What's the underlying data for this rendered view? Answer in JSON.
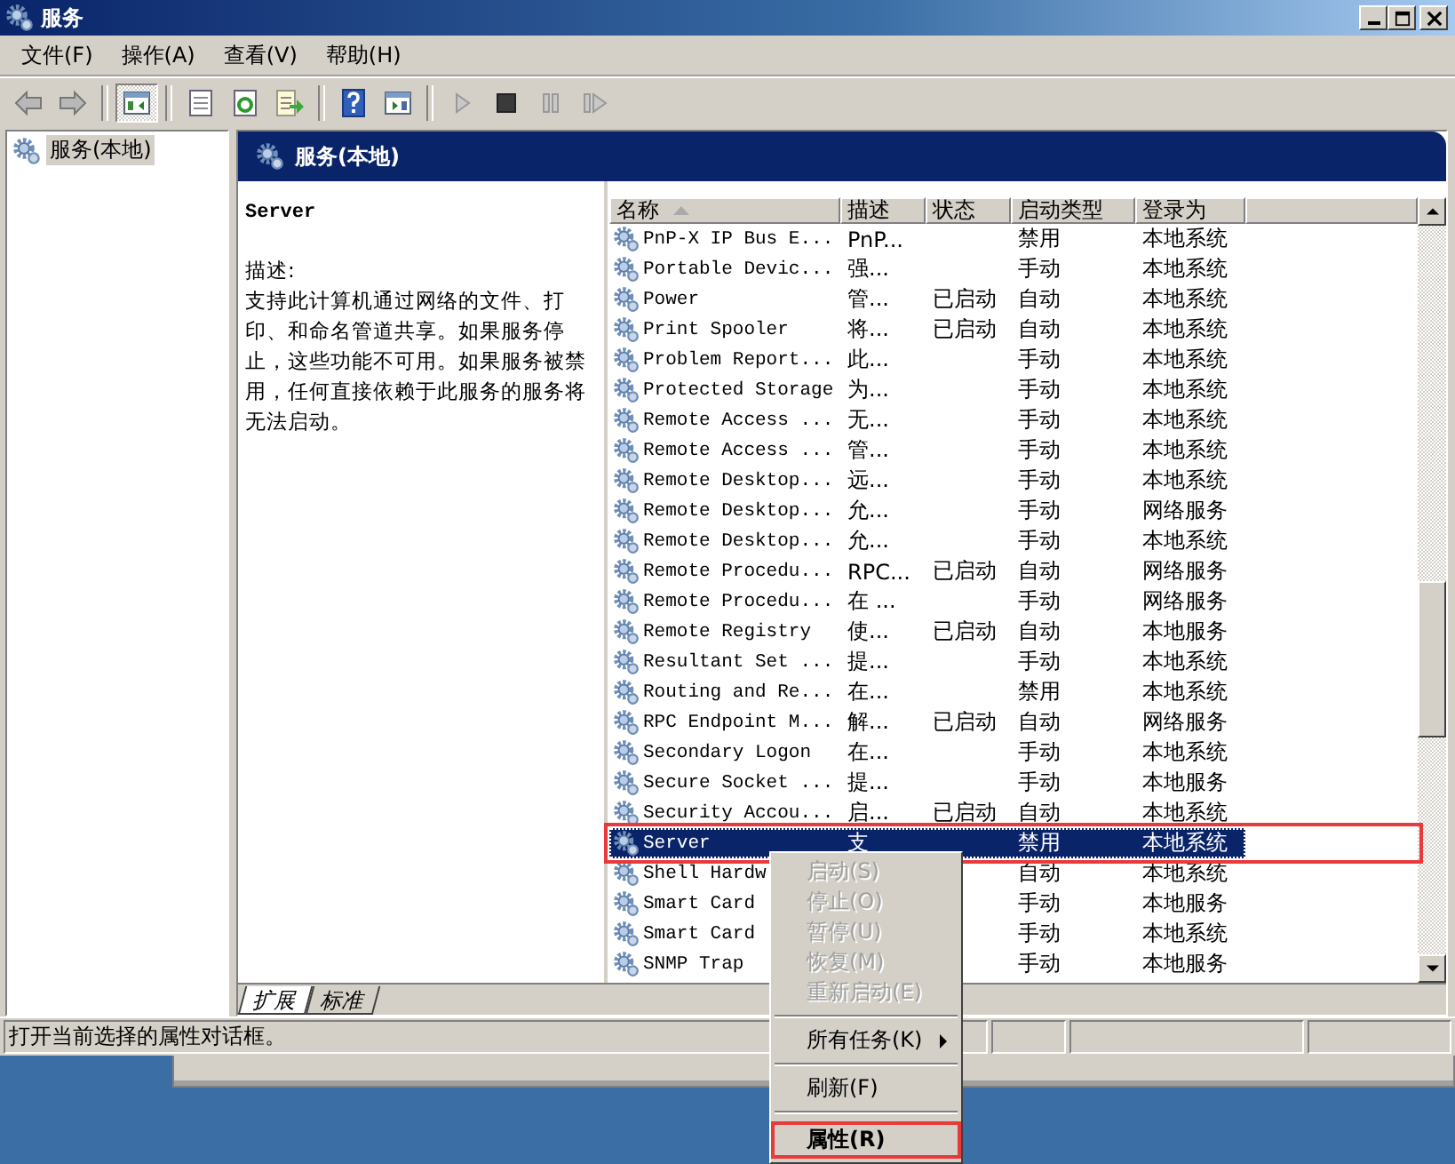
{
  "window": {
    "title": "服务"
  },
  "menu_bar": [
    "文件(F)",
    "操作(A)",
    "查看(V)",
    "帮助(H)"
  ],
  "toolbar": [
    {
      "kind": "back",
      "pressed": false
    },
    {
      "kind": "forward",
      "pressed": false
    },
    {
      "kind": "separator"
    },
    {
      "kind": "console-tree",
      "pressed": true
    },
    {
      "kind": "separator"
    },
    {
      "kind": "properties",
      "pressed": false
    },
    {
      "kind": "refresh",
      "pressed": false
    },
    {
      "kind": "export",
      "pressed": false
    },
    {
      "kind": "separator"
    },
    {
      "kind": "help",
      "pressed": false
    },
    {
      "kind": "action-pane",
      "pressed": false
    },
    {
      "kind": "separator"
    },
    {
      "kind": "play",
      "pressed": false,
      "disabled": true
    },
    {
      "kind": "stop",
      "pressed": false,
      "disabled": false
    },
    {
      "kind": "pause",
      "pressed": false,
      "disabled": true
    },
    {
      "kind": "resume",
      "pressed": false,
      "disabled": true
    }
  ],
  "tree": [
    {
      "label": "服务(本地)",
      "selected": true
    }
  ],
  "header": {
    "title": "服务(本地)"
  },
  "description": {
    "service_name": "Server",
    "label": "描述:",
    "text": "支持此计算机通过网络的文件、打印、和命名管道共享。如果服务停止，这些功能不可用。如果服务被禁用，任何直接依赖于此服务的服务将无法启动。"
  },
  "columns": [
    {
      "label": "名称",
      "sorted": true
    },
    {
      "label": "描述",
      "sorted": false
    },
    {
      "label": "状态",
      "sorted": false
    },
    {
      "label": "启动类型",
      "sorted": false
    },
    {
      "label": "登录为",
      "sorted": false
    }
  ],
  "rows": [
    {
      "name": "PnP-X IP Bus E...",
      "description": "PnP...",
      "status": "",
      "startup": "禁用",
      "logon": "本地系统",
      "selected": false,
      "highlighted": false
    },
    {
      "name": "Portable Devic...",
      "description": "强...",
      "status": "",
      "startup": "手动",
      "logon": "本地系统",
      "selected": false,
      "highlighted": false
    },
    {
      "name": "Power",
      "description": "管...",
      "status": "已启动",
      "startup": "自动",
      "logon": "本地系统",
      "selected": false,
      "highlighted": false
    },
    {
      "name": "Print Spooler",
      "description": "将...",
      "status": "已启动",
      "startup": "自动",
      "logon": "本地系统",
      "selected": false,
      "highlighted": false
    },
    {
      "name": "Problem Report...",
      "description": "此...",
      "status": "",
      "startup": "手动",
      "logon": "本地系统",
      "selected": false,
      "highlighted": false
    },
    {
      "name": "Protected Storage",
      "description": "为...",
      "status": "",
      "startup": "手动",
      "logon": "本地系统",
      "selected": false,
      "highlighted": false
    },
    {
      "name": "Remote Access ...",
      "description": "无...",
      "status": "",
      "startup": "手动",
      "logon": "本地系统",
      "selected": false,
      "highlighted": false
    },
    {
      "name": "Remote Access ...",
      "description": "管...",
      "status": "",
      "startup": "手动",
      "logon": "本地系统",
      "selected": false,
      "highlighted": false
    },
    {
      "name": "Remote Desktop...",
      "description": "远...",
      "status": "",
      "startup": "手动",
      "logon": "本地系统",
      "selected": false,
      "highlighted": false
    },
    {
      "name": "Remote Desktop...",
      "description": "允...",
      "status": "",
      "startup": "手动",
      "logon": "网络服务",
      "selected": false,
      "highlighted": false
    },
    {
      "name": "Remote Desktop...",
      "description": "允...",
      "status": "",
      "startup": "手动",
      "logon": "本地系统",
      "selected": false,
      "highlighted": false
    },
    {
      "name": "Remote Procedu...",
      "description": "RPC...",
      "status": "已启动",
      "startup": "自动",
      "logon": "网络服务",
      "selected": false,
      "highlighted": false
    },
    {
      "name": "Remote Procedu...",
      "description": "在 ...",
      "status": "",
      "startup": "手动",
      "logon": "网络服务",
      "selected": false,
      "highlighted": false
    },
    {
      "name": "Remote Registry",
      "description": "使...",
      "status": "已启动",
      "startup": "自动",
      "logon": "本地服务",
      "selected": false,
      "highlighted": false
    },
    {
      "name": "Resultant Set ...",
      "description": "提...",
      "status": "",
      "startup": "手动",
      "logon": "本地系统",
      "selected": false,
      "highlighted": false
    },
    {
      "name": "Routing and Re...",
      "description": "在...",
      "status": "",
      "startup": "禁用",
      "logon": "本地系统",
      "selected": false,
      "highlighted": false
    },
    {
      "name": "RPC Endpoint M...",
      "description": "解...",
      "status": "已启动",
      "startup": "自动",
      "logon": "网络服务",
      "selected": false,
      "highlighted": false
    },
    {
      "name": "Secondary Logon",
      "description": "在...",
      "status": "",
      "startup": "手动",
      "logon": "本地系统",
      "selected": false,
      "highlighted": false
    },
    {
      "name": "Secure Socket ...",
      "description": "提...",
      "status": "",
      "startup": "手动",
      "logon": "本地服务",
      "selected": false,
      "highlighted": false
    },
    {
      "name": "Security Accou...",
      "description": "启...",
      "status": "已启动",
      "startup": "自动",
      "logon": "本地系统",
      "selected": false,
      "highlighted": false
    },
    {
      "name": "Server",
      "description": "支",
      "status": "",
      "startup": "禁用",
      "logon": "本地系统",
      "selected": true,
      "highlighted": true
    },
    {
      "name": "Shell Hardw",
      "description": "",
      "status": "",
      "startup": "自动",
      "logon": "本地系统",
      "selected": false,
      "highlighted": false
    },
    {
      "name": "Smart Card",
      "description": "",
      "status": "",
      "startup": "手动",
      "logon": "本地服务",
      "selected": false,
      "highlighted": false
    },
    {
      "name": "Smart Card",
      "description": "",
      "status": "",
      "startup": "手动",
      "logon": "本地系统",
      "selected": false,
      "highlighted": false
    },
    {
      "name": "SNMP Trap",
      "description": "",
      "status": "",
      "startup": "手动",
      "logon": "本地服务",
      "selected": false,
      "highlighted": false
    }
  ],
  "tabs": [
    {
      "label": "扩展",
      "selected": true
    },
    {
      "label": "标准",
      "selected": false
    }
  ],
  "status_bar": "打开当前选择的属性对话框。",
  "context_menu": [
    {
      "kind": "item",
      "label": "启动(S)",
      "disabled": true,
      "default": false,
      "submenu": false,
      "highlighted": false
    },
    {
      "kind": "item",
      "label": "停止(O)",
      "disabled": true,
      "default": false,
      "submenu": false,
      "highlighted": false
    },
    {
      "kind": "item",
      "label": "暂停(U)",
      "disabled": true,
      "default": false,
      "submenu": false,
      "highlighted": false
    },
    {
      "kind": "item",
      "label": "恢复(M)",
      "disabled": true,
      "default": false,
      "submenu": false,
      "highlighted": false
    },
    {
      "kind": "item",
      "label": "重新启动(E)",
      "disabled": true,
      "default": false,
      "submenu": false,
      "highlighted": false
    },
    {
      "kind": "separator"
    },
    {
      "kind": "item",
      "label": "所有任务(K)",
      "disabled": false,
      "default": false,
      "submenu": true,
      "highlighted": false
    },
    {
      "kind": "separator"
    },
    {
      "kind": "item",
      "label": "刷新(F)",
      "disabled": false,
      "default": false,
      "submenu": false,
      "highlighted": false
    },
    {
      "kind": "separator"
    },
    {
      "kind": "item",
      "label": "属性(R)",
      "disabled": false,
      "default": true,
      "submenu": false,
      "highlighted": true
    }
  ]
}
